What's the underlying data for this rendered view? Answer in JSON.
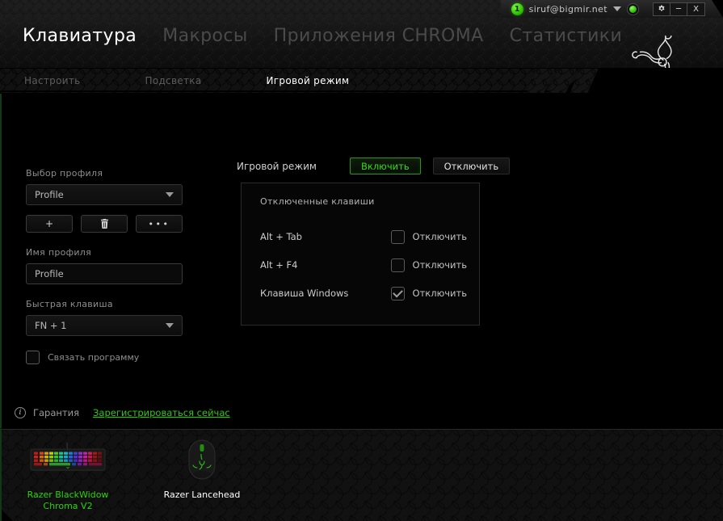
{
  "titlebar": {
    "notification_count": "1",
    "user": "siruf@bigmir.net",
    "caret_icon": "chevron-down-icon",
    "status_icon": "online-status-icon",
    "settings_label": "⚙",
    "minimize_label": "─",
    "close_label": "X"
  },
  "header": {
    "tabs": [
      {
        "label": "Клавиатура",
        "active": true
      },
      {
        "label": "Макросы",
        "active": false
      },
      {
        "label": "Приложения CHROMA",
        "active": false
      },
      {
        "label": "Статистики",
        "active": false
      }
    ],
    "logo_icon": "razer-logo-icon"
  },
  "subtabs": [
    {
      "label": "Настроить",
      "active": false
    },
    {
      "label": "Подсветка",
      "active": false
    },
    {
      "label": "Игровой режим",
      "active": true
    }
  ],
  "profile": {
    "select_label": "Выбор профиля",
    "select_value": "Profile",
    "add_label": "+",
    "delete_icon": "trash-icon",
    "more_label": "•••",
    "name_label": "Имя профиля",
    "name_value": "Profile",
    "hotkey_label": "Быстрая клавиша",
    "hotkey_value": "FN + 1",
    "link_program_label": "Связать программу",
    "link_program_checked": false
  },
  "gamemode": {
    "title": "Игровой режим",
    "enable_label": "Включить",
    "disable_label": "Отключить",
    "enabled": true,
    "panel_title": "Отключенные клавиши",
    "rows": [
      {
        "key": "Alt + Tab",
        "action_label": "Отключить",
        "checked": false
      },
      {
        "key": "Alt + F4",
        "action_label": "Отключить",
        "checked": false
      },
      {
        "key": "Клавиша Windows",
        "action_label": "Отключить",
        "checked": true
      }
    ]
  },
  "warranty": {
    "info_icon": "info-icon",
    "label": "Гарантия",
    "link": "Зарегистрироваться сейчас"
  },
  "dock": {
    "devices": [
      {
        "name": "Razer BlackWidow\nChroma V2",
        "icon": "keyboard-icon",
        "selected": true
      },
      {
        "name": "Razer Lancehead",
        "icon": "mouse-icon",
        "selected": false
      }
    ]
  },
  "colors": {
    "accent_green": "#2fd00f",
    "background": "#000000",
    "panel_border": "#2b2b2b"
  }
}
